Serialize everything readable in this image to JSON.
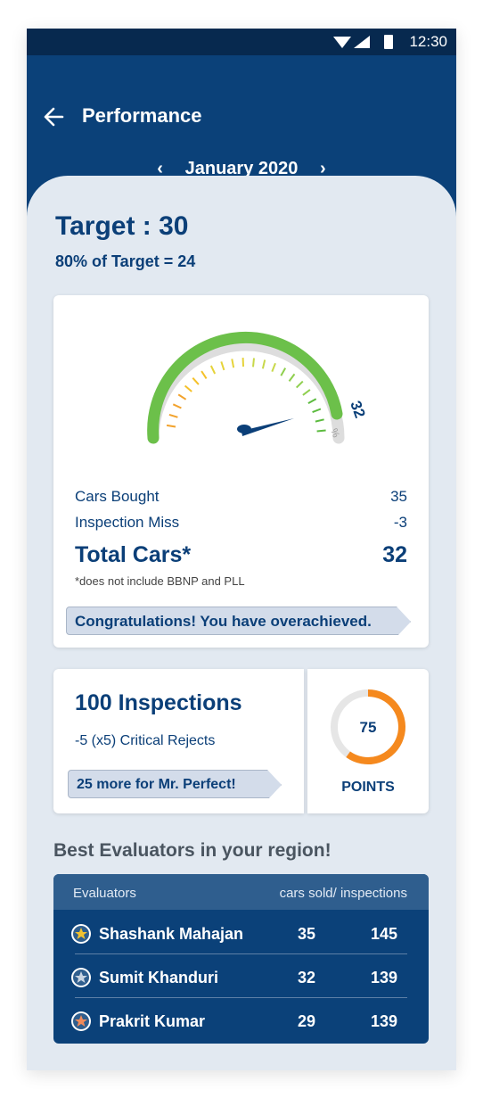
{
  "status_bar": {
    "time": "12:30"
  },
  "header": {
    "title": "Performance",
    "month": "January 2020"
  },
  "target": {
    "title": "Target : 30",
    "subtitle": "80% of Target = 24"
  },
  "gauge": {
    "value_label": "32",
    "percent_symbol": "%",
    "level": 32,
    "colors": {
      "track": "#dddddd",
      "fill": "#6cc04a",
      "needle": "#0b3f78"
    }
  },
  "stats": {
    "cars_bought_label": "Cars Bought",
    "cars_bought_value": "35",
    "inspection_miss_label": "Inspection Miss",
    "inspection_miss_value": "-3",
    "total_label": "Total Cars*",
    "total_value": "32",
    "footnote": "*does not include BBNP and PLL",
    "banner": "Congratulations! You have overachieved."
  },
  "inspections": {
    "title": "100 Inspections",
    "subtitle": "-5 (x5) Critical Rejects",
    "banner": "25 more for Mr. Perfect!"
  },
  "points": {
    "value": "75",
    "label": "POINTS",
    "fraction": 0.6,
    "colors": {
      "track": "#e6e6e6",
      "fill": "#f5891e"
    }
  },
  "evaluators": {
    "title": "Best Evaluators in your region!",
    "col_name": "Evaluators",
    "col_stats": "cars sold/ inspections",
    "rows": [
      {
        "name": "Shashank Mahajan",
        "sold": "35",
        "inspections": "145",
        "star_color": "#f2c230"
      },
      {
        "name": "Sumit Khanduri",
        "sold": "32",
        "inspections": "139",
        "star_color": "#c9d4e2"
      },
      {
        "name": "Prakrit Kumar",
        "sold": "29",
        "inspections": "139",
        "star_color": "#f08a5a"
      }
    ]
  },
  "icons": [
    "wifi-icon",
    "signal-icon",
    "battery-icon",
    "back-arrow-icon",
    "chevron-left-icon",
    "chevron-right-icon",
    "star-icon"
  ]
}
